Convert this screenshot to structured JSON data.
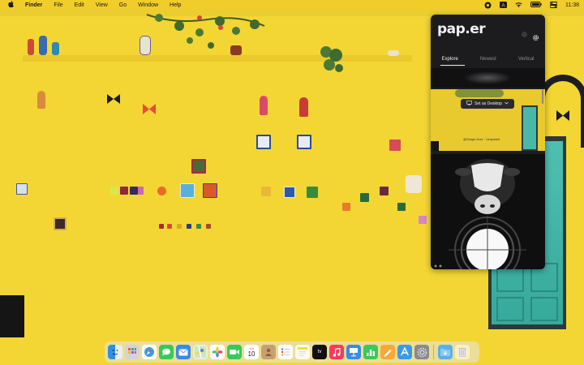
{
  "menubar": {
    "app_name": "Finder",
    "menus": [
      "File",
      "Edit",
      "View",
      "Go",
      "Window",
      "Help"
    ],
    "clock": "11:38"
  },
  "paper_app": {
    "logo": "pap.er",
    "tabs": [
      "Explore",
      "Newest",
      "Vertical"
    ],
    "active_tab": "Explore",
    "set_desktop_label": "Set as Desktop",
    "photo_credit": "@Sergio Arze · Unsplash"
  },
  "dock": {
    "calendar_month": "JUN",
    "calendar_day": "10",
    "apps": [
      "Finder",
      "Launchpad",
      "Safari",
      "Messages",
      "Mail",
      "Maps",
      "Photos",
      "FaceTime",
      "Calendar",
      "Contacts",
      "Reminders",
      "Notes",
      "TV",
      "Music",
      "Podcasts",
      "Keynote",
      "Numbers",
      "Pages",
      "App Store",
      "System Preferences",
      "Downloads",
      "Trash"
    ]
  }
}
